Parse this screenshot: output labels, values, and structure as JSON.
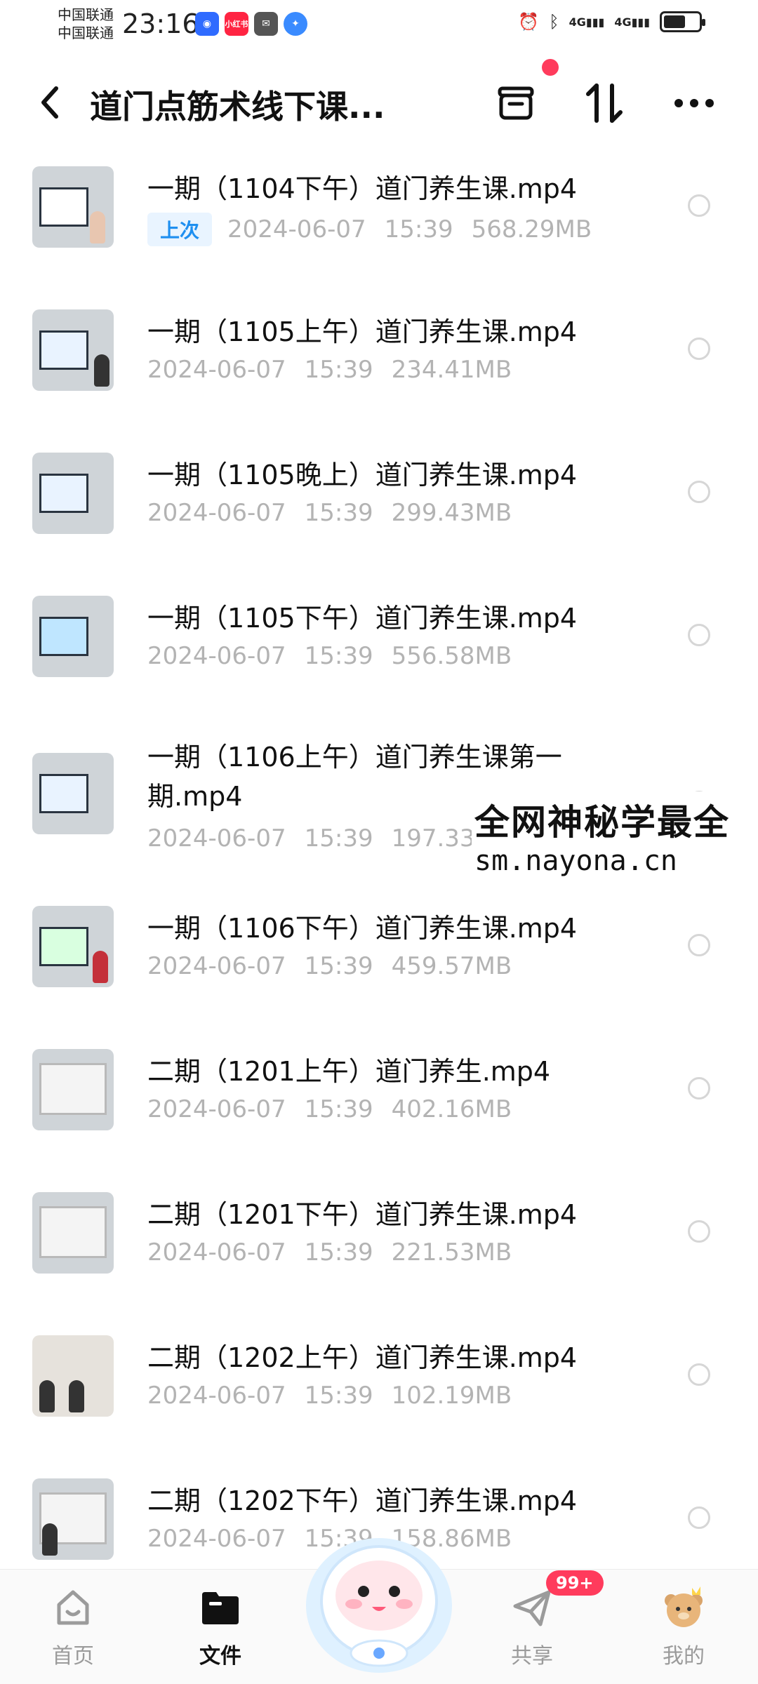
{
  "status_bar": {
    "carrier_1": "中国联通",
    "carrier_2": "中国联通",
    "time": "23:16",
    "app_badge_label": "小红书",
    "network_1": "4G",
    "network_2": "4G"
  },
  "header": {
    "title": "道门点筋术线下课...",
    "colors": {
      "notify_dot": "#ff3b5c"
    }
  },
  "files": [
    {
      "name": "一期（1104下午）道门养生课.mp4",
      "tag": "上次",
      "date": "2024-06-07",
      "time": "15:39",
      "size": "568.29MB"
    },
    {
      "name": "一期（1105上午）道门养生课.mp4",
      "date": "2024-06-07",
      "time": "15:39",
      "size": "234.41MB"
    },
    {
      "name": "一期（1105晚上）道门养生课.mp4",
      "date": "2024-06-07",
      "time": "15:39",
      "size": "299.43MB"
    },
    {
      "name": "一期（1105下午）道门养生课.mp4",
      "date": "2024-06-07",
      "time": "15:39",
      "size": "556.58MB"
    },
    {
      "name": "一期（1106上午）道门养生课第一期.mp4",
      "date": "2024-06-07",
      "time": "15:39",
      "size": "197.33MB"
    },
    {
      "name": "一期（1106下午）道门养生课.mp4",
      "date": "2024-06-07",
      "time": "15:39",
      "size": "459.57MB"
    },
    {
      "name": "二期（1201上午）道门养生.mp4",
      "date": "2024-06-07",
      "time": "15:39",
      "size": "402.16MB"
    },
    {
      "name": "二期（1201下午）道门养生课.mp4",
      "date": "2024-06-07",
      "time": "15:39",
      "size": "221.53MB"
    },
    {
      "name": "二期（1202上午）道门养生课.mp4",
      "date": "2024-06-07",
      "time": "15:39",
      "size": "102.19MB"
    },
    {
      "name": "二期（1202下午）道门养生课.mp4",
      "date": "2024-06-07",
      "time": "15:39",
      "size": "158.86MB"
    }
  ],
  "watermark": {
    "line1": "全网神秘学最全",
    "line2": "sm.nayona.cn"
  },
  "bottom_nav": {
    "items": [
      {
        "label": "首页",
        "icon": "home-icon"
      },
      {
        "label": "文件",
        "icon": "folder-icon",
        "active": true
      },
      {
        "label": "共享",
        "icon": "send-icon"
      },
      {
        "label": "我的",
        "icon": "bear-avatar-icon"
      }
    ],
    "share_badge": "99+"
  }
}
